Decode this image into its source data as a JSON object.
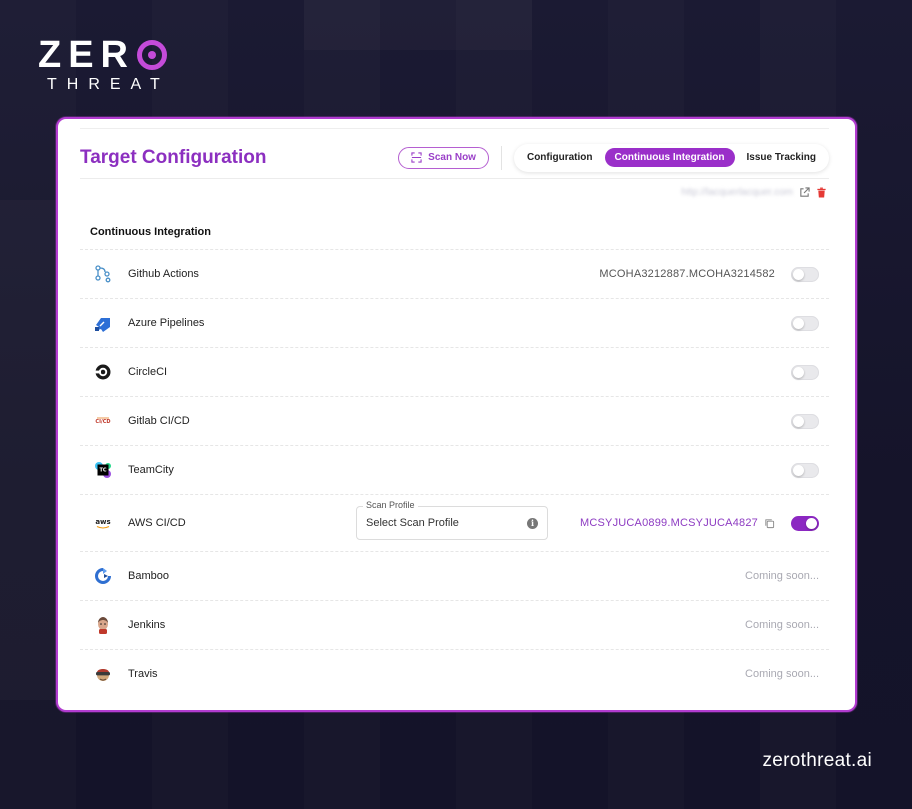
{
  "brand": {
    "logo_zero": "ZER",
    "logo_threat": "THREAT",
    "footer": "zerothreat.ai"
  },
  "header": {
    "title": "Target Configuration",
    "scan_button": "Scan Now",
    "tabs": [
      {
        "label": "Configuration",
        "active": false
      },
      {
        "label": "Continuous Integration",
        "active": true
      },
      {
        "label": "Issue Tracking",
        "active": false
      }
    ]
  },
  "target_url": "http://lacquerlacquer.com",
  "section_title": "Continuous Integration",
  "integrations": [
    {
      "name": "Github Actions",
      "code": "MCOHA3212887.MCOHA3214582",
      "toggle": "off",
      "icon": "github-actions-icon"
    },
    {
      "name": "Azure Pipelines",
      "code": "",
      "toggle": "off",
      "icon": "azure-pipelines-icon"
    },
    {
      "name": "CircleCI",
      "code": "",
      "toggle": "off",
      "icon": "circleci-icon"
    },
    {
      "name": "Gitlab CI/CD",
      "code": "",
      "toggle": "off",
      "icon": "gitlab-cicd-icon"
    },
    {
      "name": "TeamCity",
      "code": "",
      "toggle": "off",
      "icon": "teamcity-icon"
    },
    {
      "name": "AWS CI/CD",
      "code": "MCSYJUCA0899.MCSYJUCA4827",
      "toggle": "on",
      "icon": "aws-icon",
      "scan_profile_label": "Scan Profile",
      "scan_profile_value": "Select Scan Profile"
    },
    {
      "name": "Bamboo",
      "status": "Coming soon...",
      "icon": "bamboo-icon"
    },
    {
      "name": "Jenkins",
      "status": "Coming soon...",
      "icon": "jenkins-icon"
    },
    {
      "name": "Travis",
      "status": "Coming soon...",
      "icon": "travis-icon"
    }
  ],
  "colors": {
    "accent": "#9a2fc9",
    "title": "#8c2fc0",
    "background": "#16152b"
  }
}
